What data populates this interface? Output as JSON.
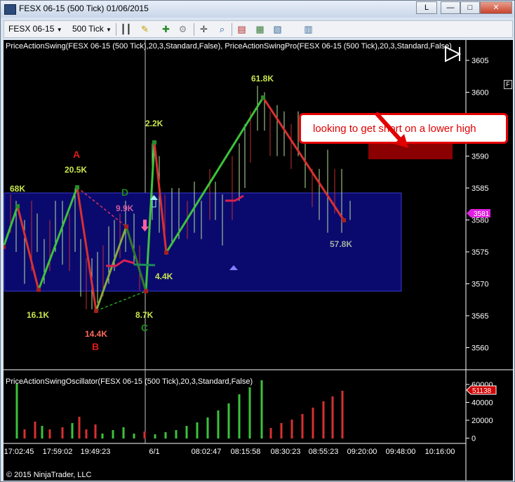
{
  "window": {
    "title": "FESX 06-15 (500 Tick)  01/06/2015",
    "buttons": {
      "link": "L",
      "minimize": "—",
      "maximize": "□",
      "close": "✕"
    }
  },
  "toolbar": {
    "instrument": "FESX 06-15",
    "interval": "500 Tick",
    "icons": [
      "bar-type-icon",
      "draw-pencil-icon",
      "add-indicator-icon",
      "strategy-icon",
      "crosshair-icon",
      "zoom-icon",
      "data-box-icon",
      "properties-icon",
      "chart-style-icon",
      "template-icon"
    ]
  },
  "chart": {
    "indicator_label": "PriceActionSwing(FESX 06-15 (500 Tick),20,3,Standard,False), PriceActionSwingPro(FESX 06-15 (500 Tick),20,3,Standard,False)",
    "oscillator_label": "PriceActionSwingOscillator(FESX 06-15 (500 Tick),20,3,Standard,False)",
    "copyright": "© 2015 NinjaTrader, LLC",
    "axis_marker": "F",
    "annotation": "looking to get short on a lower high",
    "price_ticks": [
      "3605",
      "3600",
      "3595",
      "3590",
      "3585",
      "3580",
      "3575",
      "3570",
      "3565",
      "3560"
    ],
    "last_price": "3581",
    "osc_ticks": [
      "60000",
      "40000",
      "20000",
      "0"
    ],
    "osc_last": "51138",
    "time_ticks": [
      "17:02:45",
      "17:59:02",
      "19:49:23",
      "6/1",
      "08:02:47",
      "08:15:58",
      "08:30:23",
      "08:55:23",
      "09:20:00",
      "09:48:00",
      "10:16:00"
    ],
    "swing_labels": [
      {
        "text": "68K",
        "color": "#c8e64c"
      },
      {
        "text": "16.1K",
        "color": "#c8e64c"
      },
      {
        "text": "20.5K",
        "color": "#c8e64c"
      },
      {
        "text": "14.4K",
        "color": "#ff6b5a"
      },
      {
        "text": "9.9K",
        "color": "#d05aa0"
      },
      {
        "text": "2.2K",
        "color": "#c8e64c"
      },
      {
        "text": "8.7K",
        "color": "#c8e64c"
      },
      {
        "text": "4.4K",
        "color": "#c8e64c"
      },
      {
        "text": "61.8K",
        "color": "#c8e64c"
      },
      {
        "text": "57.8K",
        "color": "#a0b0a0"
      }
    ],
    "pattern_letters": [
      {
        "text": "A",
        "color": "#e01818"
      },
      {
        "text": "B",
        "color": "#e01818"
      },
      {
        "text": "C",
        "color": "#1c8c1c"
      },
      {
        "text": "D",
        "color": "#1c8c1c"
      }
    ],
    "colors": {
      "up_swing": "#3cc23c",
      "down_swing": "#d83030",
      "range_box": "#0a0a6e",
      "range_border": "#3a3ad0",
      "highlight_box": "#8b0000"
    }
  }
}
